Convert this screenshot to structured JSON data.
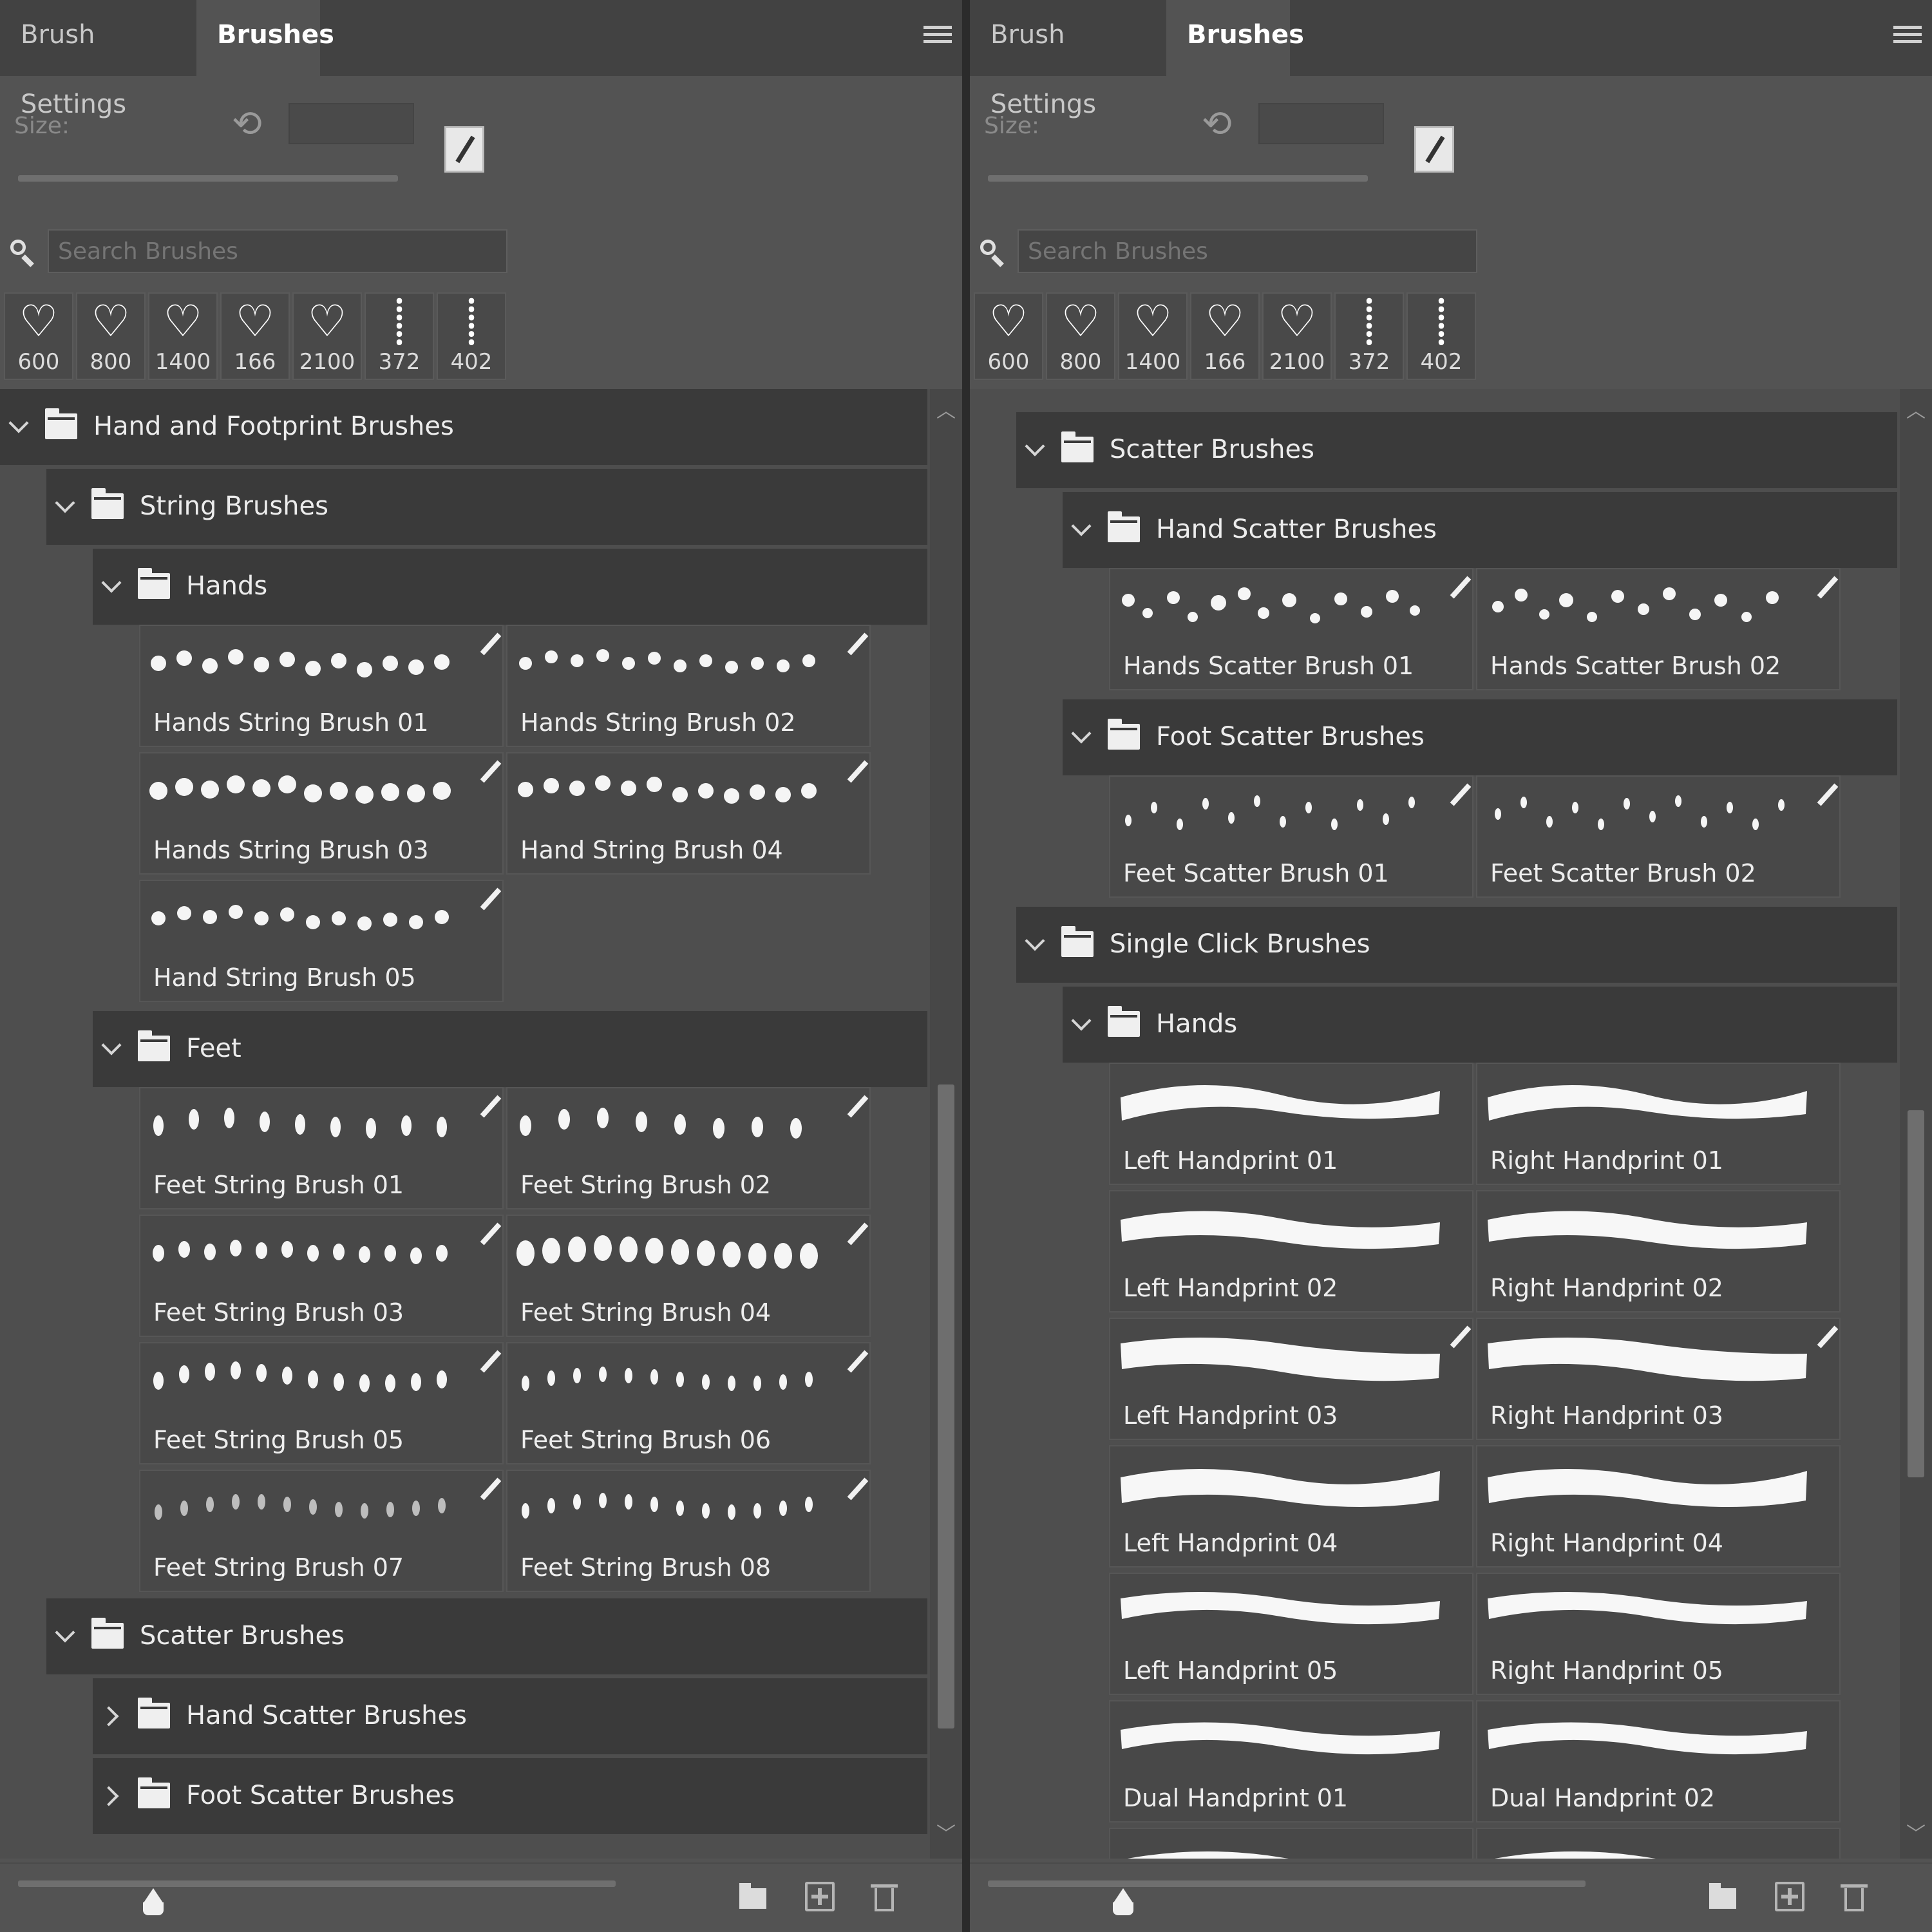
{
  "panels": [
    {
      "tabs": [
        "Brush Settings",
        "Brushes"
      ],
      "size_label": "Size:",
      "search_placeholder": "Search Brushes",
      "recent": [
        "600",
        "800",
        "1400",
        "166",
        "2100",
        "372",
        "402"
      ],
      "groups": [
        {
          "label": "Hand and Footprint Brushes",
          "expanded": true
        },
        {
          "label": "String Brushes",
          "expanded": true
        },
        {
          "label": "Hands",
          "expanded": true
        },
        {
          "label": "Feet",
          "expanded": true
        },
        {
          "label": "Scatter Brushes",
          "expanded": true
        },
        {
          "label": "Hand Scatter Brushes",
          "expanded": false
        },
        {
          "label": "Foot Scatter Brushes",
          "expanded": false
        }
      ],
      "tiles": [
        "Hands String Brush 01",
        "Hands String Brush 02",
        "Hands String Brush 03",
        "Hand String Brush 04",
        "Hand String Brush 05",
        "Feet String Brush 01",
        "Feet String Brush 02",
        "Feet String Brush 03",
        "Feet String Brush 04",
        "Feet String Brush 05",
        "Feet String Brush 06",
        "Feet String Brush 07",
        "Feet String Brush 08"
      ]
    },
    {
      "tabs": [
        "Brush Settings",
        "Brushes"
      ],
      "size_label": "Size:",
      "search_placeholder": "Search Brushes",
      "recent": [
        "600",
        "800",
        "1400",
        "166",
        "2100",
        "372",
        "402"
      ],
      "groups": [
        {
          "label": "Scatter Brushes",
          "expanded": true
        },
        {
          "label": "Hand Scatter Brushes",
          "expanded": true
        },
        {
          "label": "Foot Scatter Brushes",
          "expanded": true
        },
        {
          "label": "Single Click Brushes",
          "expanded": true
        },
        {
          "label": "Hands",
          "expanded": true
        }
      ],
      "tiles": [
        "Hands Scatter Brush 01",
        "Hands Scatter Brush 02",
        "Feet Scatter Brush 01",
        "Feet Scatter Brush 02",
        "Left Handprint 01",
        "Right Handprint 01",
        "Left Handprint 02",
        "Right Handprint 02",
        "Left Handprint 03",
        "Right Handprint 03",
        "Left Handprint 04",
        "Right Handprint 04",
        "Left Handprint 05",
        "Right Handprint 05",
        "Dual Handprint 01",
        "Dual Handprint 02"
      ]
    }
  ],
  "colors": {
    "panel": "#535353",
    "group_header": "#3a3a3a",
    "tile": "#484848",
    "text": "#e6e6e6"
  },
  "icons": [
    "menu-icon",
    "reset-icon",
    "new-preset-icon",
    "search-icon",
    "folder-icon",
    "chevron-icon",
    "brush-options-icon",
    "new-group-icon",
    "new-brush-icon",
    "trash-icon"
  ]
}
